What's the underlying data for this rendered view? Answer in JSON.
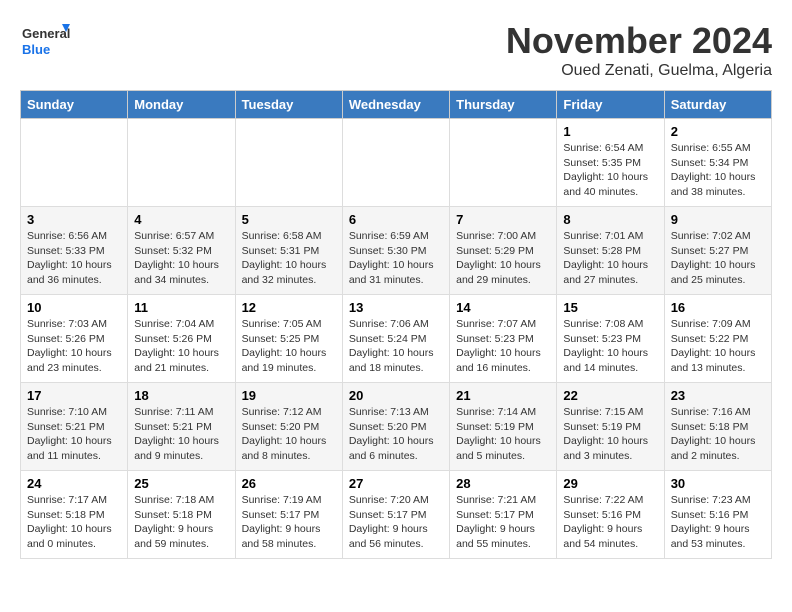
{
  "logo": {
    "line1": "General",
    "line2": "Blue"
  },
  "title": "November 2024",
  "subtitle": "Oued Zenati, Guelma, Algeria",
  "weekdays": [
    "Sunday",
    "Monday",
    "Tuesday",
    "Wednesday",
    "Thursday",
    "Friday",
    "Saturday"
  ],
  "weeks": [
    [
      {
        "day": "",
        "info": ""
      },
      {
        "day": "",
        "info": ""
      },
      {
        "day": "",
        "info": ""
      },
      {
        "day": "",
        "info": ""
      },
      {
        "day": "",
        "info": ""
      },
      {
        "day": "1",
        "info": "Sunrise: 6:54 AM\nSunset: 5:35 PM\nDaylight: 10 hours and 40 minutes."
      },
      {
        "day": "2",
        "info": "Sunrise: 6:55 AM\nSunset: 5:34 PM\nDaylight: 10 hours and 38 minutes."
      }
    ],
    [
      {
        "day": "3",
        "info": "Sunrise: 6:56 AM\nSunset: 5:33 PM\nDaylight: 10 hours and 36 minutes."
      },
      {
        "day": "4",
        "info": "Sunrise: 6:57 AM\nSunset: 5:32 PM\nDaylight: 10 hours and 34 minutes."
      },
      {
        "day": "5",
        "info": "Sunrise: 6:58 AM\nSunset: 5:31 PM\nDaylight: 10 hours and 32 minutes."
      },
      {
        "day": "6",
        "info": "Sunrise: 6:59 AM\nSunset: 5:30 PM\nDaylight: 10 hours and 31 minutes."
      },
      {
        "day": "7",
        "info": "Sunrise: 7:00 AM\nSunset: 5:29 PM\nDaylight: 10 hours and 29 minutes."
      },
      {
        "day": "8",
        "info": "Sunrise: 7:01 AM\nSunset: 5:28 PM\nDaylight: 10 hours and 27 minutes."
      },
      {
        "day": "9",
        "info": "Sunrise: 7:02 AM\nSunset: 5:27 PM\nDaylight: 10 hours and 25 minutes."
      }
    ],
    [
      {
        "day": "10",
        "info": "Sunrise: 7:03 AM\nSunset: 5:26 PM\nDaylight: 10 hours and 23 minutes."
      },
      {
        "day": "11",
        "info": "Sunrise: 7:04 AM\nSunset: 5:26 PM\nDaylight: 10 hours and 21 minutes."
      },
      {
        "day": "12",
        "info": "Sunrise: 7:05 AM\nSunset: 5:25 PM\nDaylight: 10 hours and 19 minutes."
      },
      {
        "day": "13",
        "info": "Sunrise: 7:06 AM\nSunset: 5:24 PM\nDaylight: 10 hours and 18 minutes."
      },
      {
        "day": "14",
        "info": "Sunrise: 7:07 AM\nSunset: 5:23 PM\nDaylight: 10 hours and 16 minutes."
      },
      {
        "day": "15",
        "info": "Sunrise: 7:08 AM\nSunset: 5:23 PM\nDaylight: 10 hours and 14 minutes."
      },
      {
        "day": "16",
        "info": "Sunrise: 7:09 AM\nSunset: 5:22 PM\nDaylight: 10 hours and 13 minutes."
      }
    ],
    [
      {
        "day": "17",
        "info": "Sunrise: 7:10 AM\nSunset: 5:21 PM\nDaylight: 10 hours and 11 minutes."
      },
      {
        "day": "18",
        "info": "Sunrise: 7:11 AM\nSunset: 5:21 PM\nDaylight: 10 hours and 9 minutes."
      },
      {
        "day": "19",
        "info": "Sunrise: 7:12 AM\nSunset: 5:20 PM\nDaylight: 10 hours and 8 minutes."
      },
      {
        "day": "20",
        "info": "Sunrise: 7:13 AM\nSunset: 5:20 PM\nDaylight: 10 hours and 6 minutes."
      },
      {
        "day": "21",
        "info": "Sunrise: 7:14 AM\nSunset: 5:19 PM\nDaylight: 10 hours and 5 minutes."
      },
      {
        "day": "22",
        "info": "Sunrise: 7:15 AM\nSunset: 5:19 PM\nDaylight: 10 hours and 3 minutes."
      },
      {
        "day": "23",
        "info": "Sunrise: 7:16 AM\nSunset: 5:18 PM\nDaylight: 10 hours and 2 minutes."
      }
    ],
    [
      {
        "day": "24",
        "info": "Sunrise: 7:17 AM\nSunset: 5:18 PM\nDaylight: 10 hours and 0 minutes."
      },
      {
        "day": "25",
        "info": "Sunrise: 7:18 AM\nSunset: 5:18 PM\nDaylight: 9 hours and 59 minutes."
      },
      {
        "day": "26",
        "info": "Sunrise: 7:19 AM\nSunset: 5:17 PM\nDaylight: 9 hours and 58 minutes."
      },
      {
        "day": "27",
        "info": "Sunrise: 7:20 AM\nSunset: 5:17 PM\nDaylight: 9 hours and 56 minutes."
      },
      {
        "day": "28",
        "info": "Sunrise: 7:21 AM\nSunset: 5:17 PM\nDaylight: 9 hours and 55 minutes."
      },
      {
        "day": "29",
        "info": "Sunrise: 7:22 AM\nSunset: 5:16 PM\nDaylight: 9 hours and 54 minutes."
      },
      {
        "day": "30",
        "info": "Sunrise: 7:23 AM\nSunset: 5:16 PM\nDaylight: 9 hours and 53 minutes."
      }
    ]
  ]
}
